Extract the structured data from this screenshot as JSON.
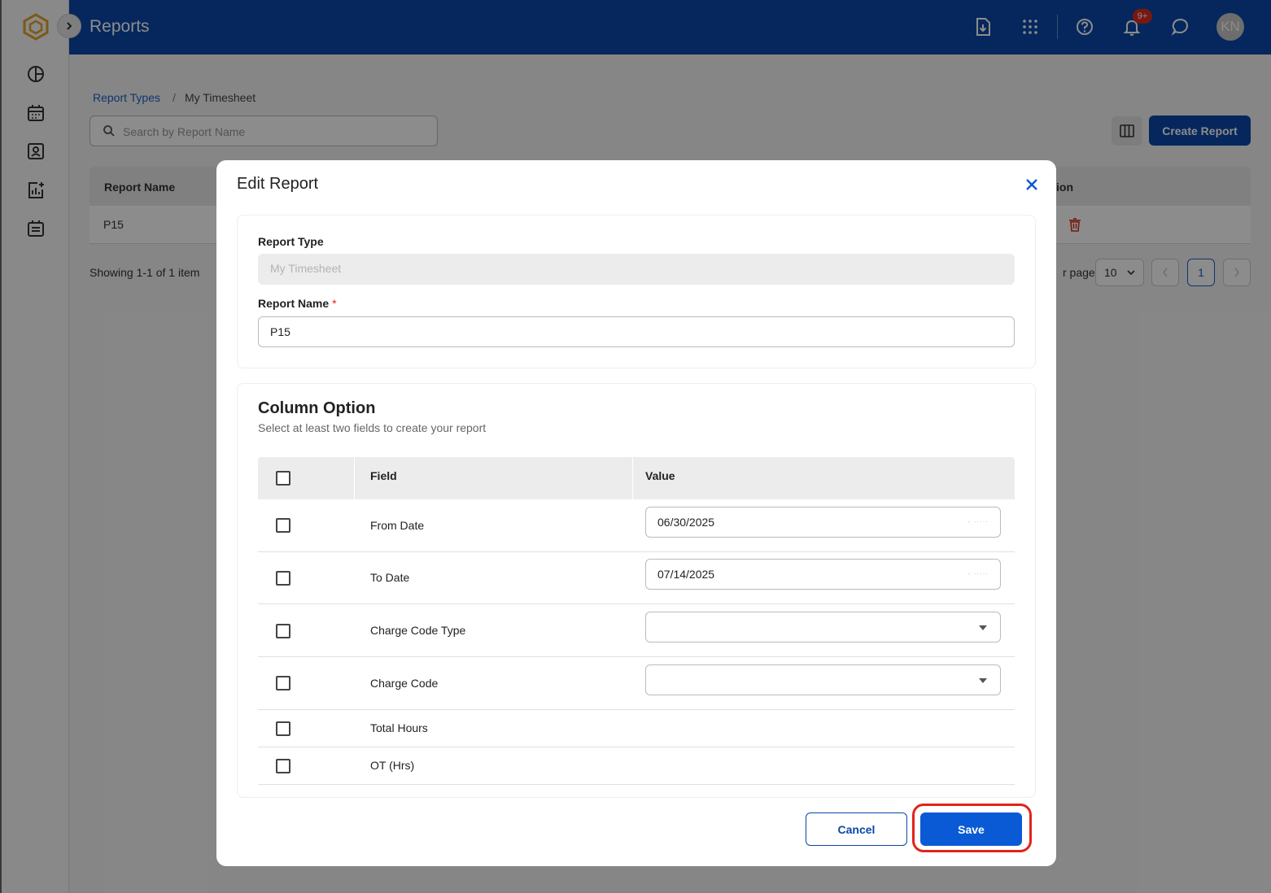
{
  "header": {
    "title": "Reports",
    "notification_badge": "9+",
    "avatar_initials": "KN"
  },
  "breadcrumb": {
    "parent": "Report Types",
    "separator": "/",
    "current": "My Timesheet"
  },
  "search": {
    "placeholder": "Search by Report Name"
  },
  "toolbar": {
    "create_label": "Create Report"
  },
  "table": {
    "headers": [
      "Report Name",
      "ion"
    ],
    "rows": [
      {
        "name": "P15"
      }
    ]
  },
  "pagination": {
    "showing": "Showing 1-1 of 1 item",
    "per_page_label": "r page",
    "page_size": "10",
    "current_page": "1"
  },
  "modal": {
    "title": "Edit Report",
    "report_type_label": "Report Type",
    "report_type_value": "My Timesheet",
    "report_name_label": "Report Name",
    "required_mark": "*",
    "report_name_value": "P15",
    "column_option": {
      "title": "Column Option",
      "subtitle": "Select at least two fields to create your report",
      "headers": {
        "field": "Field",
        "value": "Value"
      },
      "rows": [
        {
          "field": "From Date",
          "value": "06/30/2025",
          "kind": "date"
        },
        {
          "field": "To Date",
          "value": "07/14/2025",
          "kind": "date"
        },
        {
          "field": "Charge Code Type",
          "value": "",
          "kind": "select"
        },
        {
          "field": "Charge Code",
          "value": "",
          "kind": "select"
        },
        {
          "field": "Total Hours",
          "kind": "none"
        },
        {
          "field": "OT (Hrs)",
          "kind": "none"
        }
      ]
    },
    "cancel_label": "Cancel",
    "save_label": "Save"
  },
  "colors": {
    "header_bg": "#0a47a9",
    "primary": "#0a5ad6",
    "highlight_ring": "#e0241b",
    "link": "#1a5fc7"
  }
}
